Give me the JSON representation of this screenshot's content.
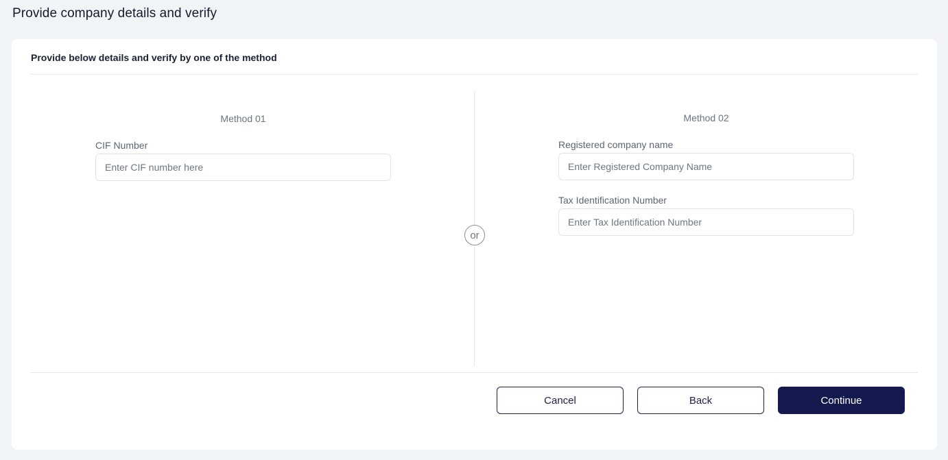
{
  "page": {
    "title": "Provide company details and verify"
  },
  "card": {
    "header": "Provide below details and verify by one of the method",
    "divider_label": "or"
  },
  "method1": {
    "title": "Method 01",
    "cif": {
      "label": "CIF Number",
      "placeholder": "Enter CIF number here",
      "value": ""
    }
  },
  "method2": {
    "title": "Method 02",
    "company_name": {
      "label": "Registered company name",
      "placeholder": "Enter Registered Company Name",
      "value": ""
    },
    "tax_id": {
      "label": "Tax Identification Number",
      "placeholder": "Enter Tax Identification Number",
      "value": ""
    }
  },
  "actions": {
    "cancel_label": "Cancel",
    "back_label": "Back",
    "continue_label": "Continue"
  },
  "colors": {
    "background": "#f1f4f7",
    "card": "#ffffff",
    "primary": "#141a4e",
    "border": "#dfe3e8"
  }
}
